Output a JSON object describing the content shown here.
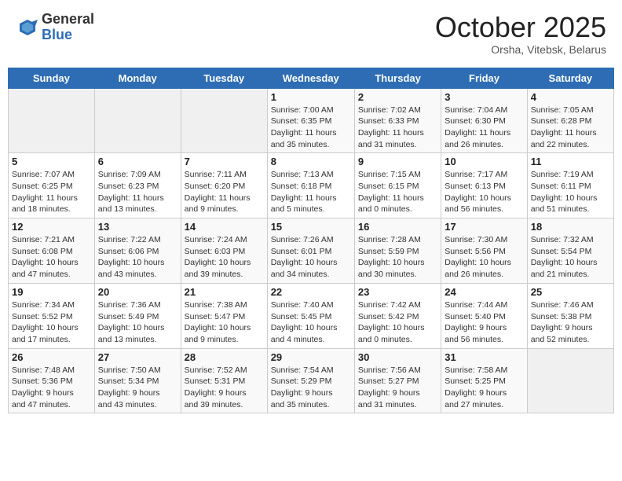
{
  "header": {
    "logo_general": "General",
    "logo_blue": "Blue",
    "month_title": "October 2025",
    "location": "Orsha, Vitebsk, Belarus"
  },
  "weekdays": [
    "Sunday",
    "Monday",
    "Tuesday",
    "Wednesday",
    "Thursday",
    "Friday",
    "Saturday"
  ],
  "weeks": [
    [
      {
        "day": "",
        "info": ""
      },
      {
        "day": "",
        "info": ""
      },
      {
        "day": "",
        "info": ""
      },
      {
        "day": "1",
        "info": "Sunrise: 7:00 AM\nSunset: 6:35 PM\nDaylight: 11 hours\nand 35 minutes."
      },
      {
        "day": "2",
        "info": "Sunrise: 7:02 AM\nSunset: 6:33 PM\nDaylight: 11 hours\nand 31 minutes."
      },
      {
        "day": "3",
        "info": "Sunrise: 7:04 AM\nSunset: 6:30 PM\nDaylight: 11 hours\nand 26 minutes."
      },
      {
        "day": "4",
        "info": "Sunrise: 7:05 AM\nSunset: 6:28 PM\nDaylight: 11 hours\nand 22 minutes."
      }
    ],
    [
      {
        "day": "5",
        "info": "Sunrise: 7:07 AM\nSunset: 6:25 PM\nDaylight: 11 hours\nand 18 minutes."
      },
      {
        "day": "6",
        "info": "Sunrise: 7:09 AM\nSunset: 6:23 PM\nDaylight: 11 hours\nand 13 minutes."
      },
      {
        "day": "7",
        "info": "Sunrise: 7:11 AM\nSunset: 6:20 PM\nDaylight: 11 hours\nand 9 minutes."
      },
      {
        "day": "8",
        "info": "Sunrise: 7:13 AM\nSunset: 6:18 PM\nDaylight: 11 hours\nand 5 minutes."
      },
      {
        "day": "9",
        "info": "Sunrise: 7:15 AM\nSunset: 6:15 PM\nDaylight: 11 hours\nand 0 minutes."
      },
      {
        "day": "10",
        "info": "Sunrise: 7:17 AM\nSunset: 6:13 PM\nDaylight: 10 hours\nand 56 minutes."
      },
      {
        "day": "11",
        "info": "Sunrise: 7:19 AM\nSunset: 6:11 PM\nDaylight: 10 hours\nand 51 minutes."
      }
    ],
    [
      {
        "day": "12",
        "info": "Sunrise: 7:21 AM\nSunset: 6:08 PM\nDaylight: 10 hours\nand 47 minutes."
      },
      {
        "day": "13",
        "info": "Sunrise: 7:22 AM\nSunset: 6:06 PM\nDaylight: 10 hours\nand 43 minutes."
      },
      {
        "day": "14",
        "info": "Sunrise: 7:24 AM\nSunset: 6:03 PM\nDaylight: 10 hours\nand 39 minutes."
      },
      {
        "day": "15",
        "info": "Sunrise: 7:26 AM\nSunset: 6:01 PM\nDaylight: 10 hours\nand 34 minutes."
      },
      {
        "day": "16",
        "info": "Sunrise: 7:28 AM\nSunset: 5:59 PM\nDaylight: 10 hours\nand 30 minutes."
      },
      {
        "day": "17",
        "info": "Sunrise: 7:30 AM\nSunset: 5:56 PM\nDaylight: 10 hours\nand 26 minutes."
      },
      {
        "day": "18",
        "info": "Sunrise: 7:32 AM\nSunset: 5:54 PM\nDaylight: 10 hours\nand 21 minutes."
      }
    ],
    [
      {
        "day": "19",
        "info": "Sunrise: 7:34 AM\nSunset: 5:52 PM\nDaylight: 10 hours\nand 17 minutes."
      },
      {
        "day": "20",
        "info": "Sunrise: 7:36 AM\nSunset: 5:49 PM\nDaylight: 10 hours\nand 13 minutes."
      },
      {
        "day": "21",
        "info": "Sunrise: 7:38 AM\nSunset: 5:47 PM\nDaylight: 10 hours\nand 9 minutes."
      },
      {
        "day": "22",
        "info": "Sunrise: 7:40 AM\nSunset: 5:45 PM\nDaylight: 10 hours\nand 4 minutes."
      },
      {
        "day": "23",
        "info": "Sunrise: 7:42 AM\nSunset: 5:42 PM\nDaylight: 10 hours\nand 0 minutes."
      },
      {
        "day": "24",
        "info": "Sunrise: 7:44 AM\nSunset: 5:40 PM\nDaylight: 9 hours\nand 56 minutes."
      },
      {
        "day": "25",
        "info": "Sunrise: 7:46 AM\nSunset: 5:38 PM\nDaylight: 9 hours\nand 52 minutes."
      }
    ],
    [
      {
        "day": "26",
        "info": "Sunrise: 7:48 AM\nSunset: 5:36 PM\nDaylight: 9 hours\nand 47 minutes."
      },
      {
        "day": "27",
        "info": "Sunrise: 7:50 AM\nSunset: 5:34 PM\nDaylight: 9 hours\nand 43 minutes."
      },
      {
        "day": "28",
        "info": "Sunrise: 7:52 AM\nSunset: 5:31 PM\nDaylight: 9 hours\nand 39 minutes."
      },
      {
        "day": "29",
        "info": "Sunrise: 7:54 AM\nSunset: 5:29 PM\nDaylight: 9 hours\nand 35 minutes."
      },
      {
        "day": "30",
        "info": "Sunrise: 7:56 AM\nSunset: 5:27 PM\nDaylight: 9 hours\nand 31 minutes."
      },
      {
        "day": "31",
        "info": "Sunrise: 7:58 AM\nSunset: 5:25 PM\nDaylight: 9 hours\nand 27 minutes."
      },
      {
        "day": "",
        "info": ""
      }
    ]
  ]
}
